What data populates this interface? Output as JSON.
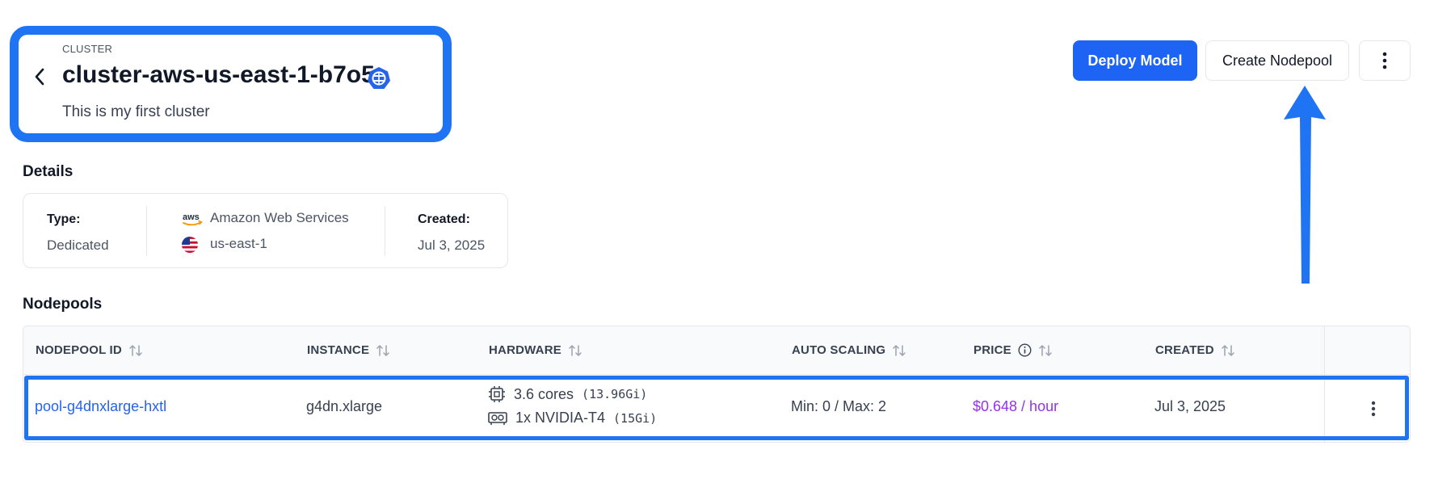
{
  "header": {
    "eyebrow": "CLUSTER",
    "title": "cluster-aws-us-east-1-b7o5",
    "subtitle": "This is my first cluster",
    "badge_icon": "kubernetes-icon"
  },
  "actions": {
    "deploy_label": "Deploy Model",
    "create_label": "Create Nodepool",
    "more_icon": "kebab-icon"
  },
  "details": {
    "section_title": "Details",
    "type_label": "Type:",
    "type_value": "Dedicated",
    "provider": "Amazon Web Services",
    "provider_logo_text": "aws",
    "region": "us-east-1",
    "created_label": "Created:",
    "created_value": "Jul 3, 2025"
  },
  "nodepools": {
    "section_title": "Nodepools",
    "columns": [
      "NODEPOOL ID",
      "INSTANCE",
      "HARDWARE",
      "AUTO SCALING",
      "PRICE",
      "CREATED"
    ],
    "rows": [
      {
        "id": "pool-g4dnxlarge-hxtl",
        "instance": "g4dn.xlarge",
        "cpu": "3.6 cores",
        "cpu_mem": "(13.96Gi)",
        "gpu": "1x NVIDIA-T4",
        "gpu_mem": "(15Gi)",
        "auto_scaling": "Min: 0 / Max: 2",
        "price": "$0.648 / hour",
        "created": "Jul 3, 2025"
      }
    ]
  },
  "colors": {
    "primary": "#1d64f5",
    "highlight": "#1e74f2",
    "link": "#2563eb",
    "price": "#9333ea"
  }
}
